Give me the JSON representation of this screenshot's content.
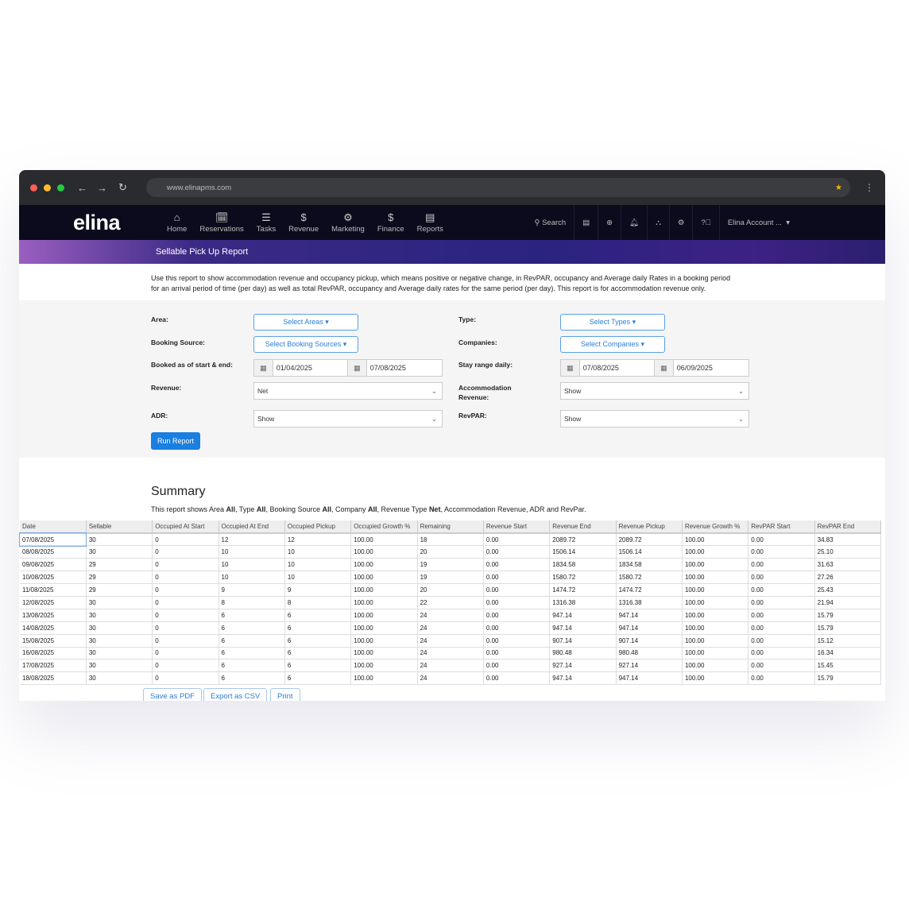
{
  "browser": {
    "url": "www.elinapms.com"
  },
  "nav": {
    "logo": "elina",
    "items": [
      {
        "label": "Home",
        "icon": "⌂"
      },
      {
        "label": "Reservations",
        "icon": "🗓"
      },
      {
        "label": "Tasks",
        "icon": "☰"
      },
      {
        "label": "Revenue",
        "icon": "$"
      },
      {
        "label": "Marketing",
        "icon": "⚙"
      },
      {
        "label": "Finance",
        "icon": "$"
      },
      {
        "label": "Reports",
        "icon": "▤"
      }
    ],
    "search": "Search",
    "account": "Elina Account ..."
  },
  "page": {
    "title": "Sellable Pick Up Report",
    "description": "Use this report to show accommodation revenue and occupancy pickup, which means positive or negative change, in RevPAR, occupancy and Average daily Rates in a booking period for an arrival period of time (per day) as well as total RevPAR, occupancy and Average daily rates for the same period (per day). This report is for accommodation revenue only."
  },
  "filters": {
    "area_label": "Area:",
    "area_btn": "Select Areas ▾",
    "type_label": "Type:",
    "type_btn": "Select Types ▾",
    "source_label": "Booking Source:",
    "source_btn": "Select Booking Sources ▾",
    "companies_label": "Companies:",
    "companies_btn": "Select Companies ▾",
    "booked_label": "Booked as of start & end:",
    "booked_start": "01/04/2025",
    "booked_end": "07/08/2025",
    "stay_label": "Stay range daily:",
    "stay_start": "07/08/2025",
    "stay_end": "06/09/2025",
    "revenue_label": "Revenue:",
    "revenue_value": "Net",
    "accom_label": "Accommodation Revenue:",
    "accom_value": "Show",
    "adr_label": "ADR:",
    "adr_value": "Show",
    "revpar_label": "RevPAR:",
    "revpar_value": "Show",
    "run": "Run Report"
  },
  "summary": {
    "title": "Summary",
    "text_parts": [
      "This report shows Area ",
      "All",
      ", Type ",
      "All",
      ", Booking Source ",
      "All",
      ", Company ",
      "All",
      ", Revenue Type ",
      "Net",
      ", Accommodation Revenue, ADR and RevPar."
    ]
  },
  "table": {
    "columns": [
      "Date",
      "Sellable",
      "Occupied At Start",
      "Occupied At End",
      "Occupied Pickup",
      "Occupied Growth %",
      "Remaining",
      "Revenue Start",
      "Revenue End",
      "Revenue Pickup",
      "Revenue Growth %",
      "RevPAR Start",
      "RevPAR End"
    ],
    "rows": [
      [
        "07/08/2025",
        "30",
        "0",
        "12",
        "12",
        "100.00",
        "18",
        "0.00",
        "2089.72",
        "2089.72",
        "100.00",
        "0.00",
        "34.83"
      ],
      [
        "08/08/2025",
        "30",
        "0",
        "10",
        "10",
        "100.00",
        "20",
        "0.00",
        "1506.14",
        "1506.14",
        "100.00",
        "0.00",
        "25.10"
      ],
      [
        "09/08/2025",
        "29",
        "0",
        "10",
        "10",
        "100.00",
        "19",
        "0.00",
        "1834.58",
        "1834.58",
        "100.00",
        "0.00",
        "31.63"
      ],
      [
        "10/08/2025",
        "29",
        "0",
        "10",
        "10",
        "100.00",
        "19",
        "0.00",
        "1580.72",
        "1580.72",
        "100.00",
        "0.00",
        "27.26"
      ],
      [
        "11/08/2025",
        "29",
        "0",
        "9",
        "9",
        "100.00",
        "20",
        "0.00",
        "1474.72",
        "1474.72",
        "100.00",
        "0.00",
        "25.43"
      ],
      [
        "12/08/2025",
        "30",
        "0",
        "8",
        "8",
        "100.00",
        "22",
        "0.00",
        "1316.38",
        "1316.38",
        "100.00",
        "0.00",
        "21.94"
      ],
      [
        "13/08/2025",
        "30",
        "0",
        "6",
        "6",
        "100.00",
        "24",
        "0.00",
        "947.14",
        "947.14",
        "100.00",
        "0.00",
        "15.79"
      ],
      [
        "14/08/2025",
        "30",
        "0",
        "6",
        "6",
        "100.00",
        "24",
        "0.00",
        "947.14",
        "947.14",
        "100.00",
        "0.00",
        "15.79"
      ],
      [
        "15/08/2025",
        "30",
        "0",
        "6",
        "6",
        "100.00",
        "24",
        "0.00",
        "907.14",
        "907.14",
        "100.00",
        "0.00",
        "15.12"
      ],
      [
        "16/08/2025",
        "30",
        "0",
        "6",
        "6",
        "100.00",
        "24",
        "0.00",
        "980.48",
        "980.48",
        "100.00",
        "0.00",
        "16.34"
      ],
      [
        "17/08/2025",
        "30",
        "0",
        "6",
        "6",
        "100.00",
        "24",
        "0.00",
        "927.14",
        "927.14",
        "100.00",
        "0.00",
        "15.45"
      ],
      [
        "18/08/2025",
        "30",
        "0",
        "6",
        "6",
        "100.00",
        "24",
        "0.00",
        "947.14",
        "947.14",
        "100.00",
        "0.00",
        "15.79"
      ]
    ]
  },
  "export": {
    "pdf": "Save as PDF",
    "csv": "Export as CSV",
    "print": "Print"
  }
}
